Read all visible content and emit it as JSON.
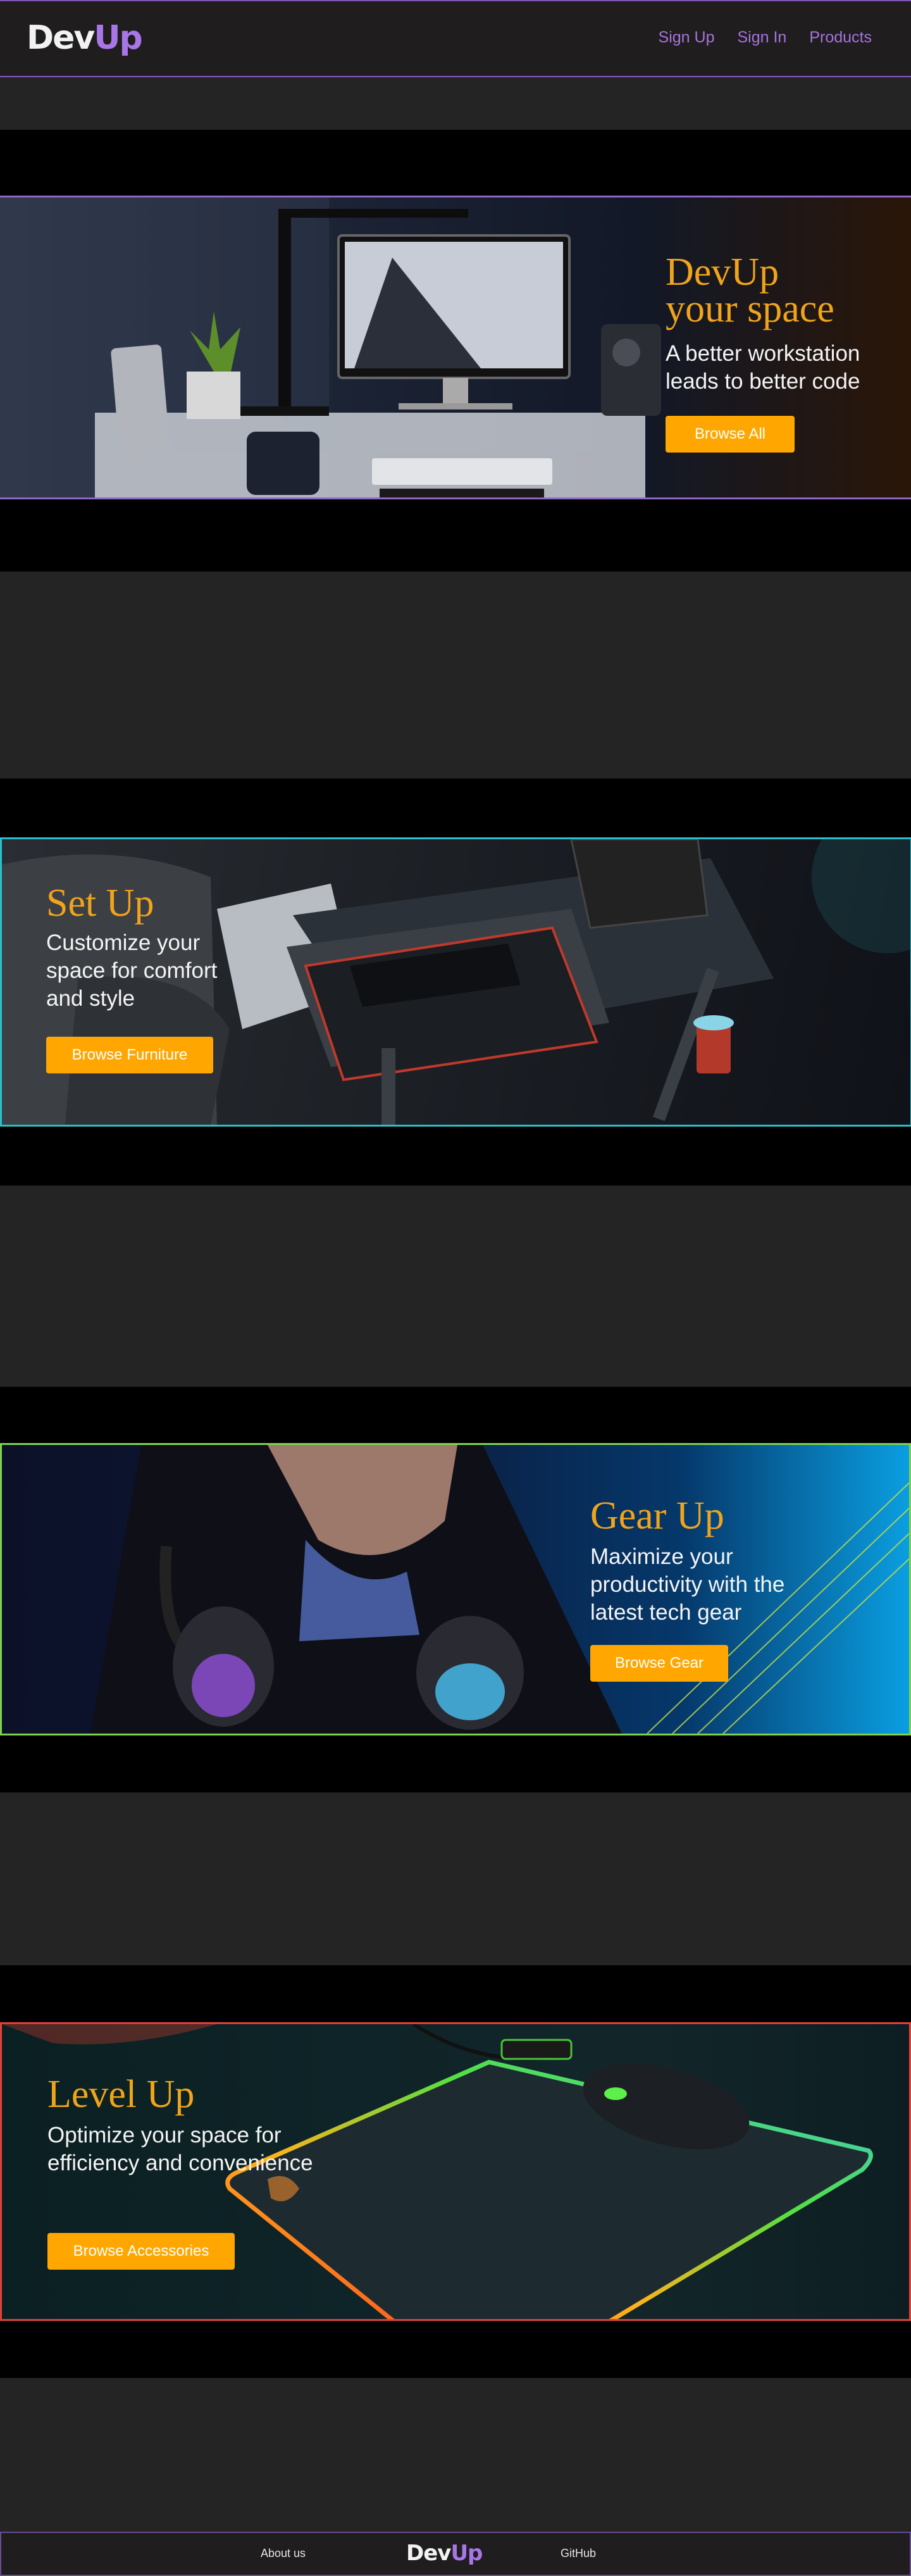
{
  "nav": {
    "logo_main": "Dev",
    "logo_accent": "Up",
    "links": [
      "Sign Up",
      "Sign In",
      "Products"
    ]
  },
  "banners": [
    {
      "title_line1": "DevUp",
      "title_line2": "your space",
      "subtitle": "A better workstation leads to better code",
      "button": "Browse All"
    },
    {
      "title_line1": "Set Up",
      "subtitle": "Customize your space for comfort and style",
      "button": "Browse Furniture"
    },
    {
      "title_line1": "Gear Up",
      "subtitle": "Maximize your productivity with the latest tech gear",
      "button": "Browse Gear"
    },
    {
      "title_line1": "Level Up",
      "subtitle": "Optimize your space for efficiency and convenience",
      "button": "Browse Accessories"
    }
  ],
  "footer": {
    "about": "About us",
    "logo_main": "Dev",
    "logo_accent": "Up",
    "github": "GitHub"
  },
  "colors": {
    "accent_purple": "#a876e6",
    "title_orange": "#f0a41a",
    "button_orange": "#ffa700",
    "background": "#242424"
  }
}
